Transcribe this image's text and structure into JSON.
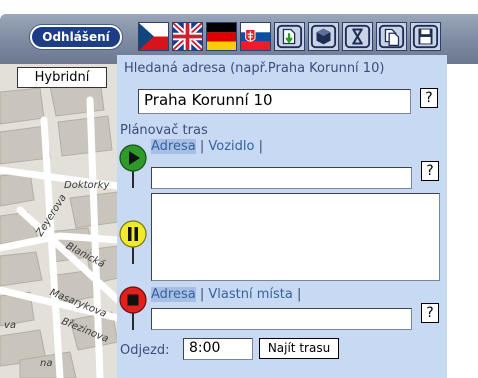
{
  "toolbar": {
    "login_label": "Odhlášení",
    "buttons": [
      {
        "name": "flag-cz-button",
        "icon": "flag-cz-icon"
      },
      {
        "name": "flag-uk-button",
        "icon": "flag-uk-icon"
      },
      {
        "name": "flag-de-button",
        "icon": "flag-de-icon"
      },
      {
        "name": "flag-sk-button",
        "icon": "flag-sk-icon"
      },
      {
        "name": "export-button",
        "icon": "document-download-icon"
      },
      {
        "name": "view-3d-button",
        "icon": "cube-icon"
      },
      {
        "name": "timer-button",
        "icon": "hourglass-icon"
      },
      {
        "name": "copy-button",
        "icon": "copy-document-icon"
      },
      {
        "name": "save-button",
        "icon": "floppy-disk-icon"
      }
    ]
  },
  "map": {
    "hybrid_label": "Hybridní",
    "streets": [
      "Doktorky",
      "Zeyerova",
      "Blanická",
      "Masarykova",
      "Březinova",
      "va",
      "na"
    ]
  },
  "search": {
    "label": "Hledaná adresa (např.Praha Korunní 10)",
    "value": "Praha Korunní 10",
    "help_label": "?"
  },
  "planner": {
    "title": "Plánovač tras",
    "start_tabs": [
      "Adresa",
      "Vozidlo"
    ],
    "end_tabs": [
      "Adresa",
      "Vlastní místa"
    ],
    "sep": "|",
    "help_label": "?",
    "start_value": "",
    "waypoints_value": "",
    "end_value": "",
    "departure_label": "Odjezd:",
    "departure_value": "8:00",
    "find_route_label": "Najít trasu"
  },
  "colors": {
    "panel": "#c8d9f4",
    "login": "#1d3d86",
    "link": "#36629f",
    "pin_start": "#2e9a2a",
    "pin_waypoint": "#f0ea2f",
    "pin_end": "#e0211c"
  }
}
